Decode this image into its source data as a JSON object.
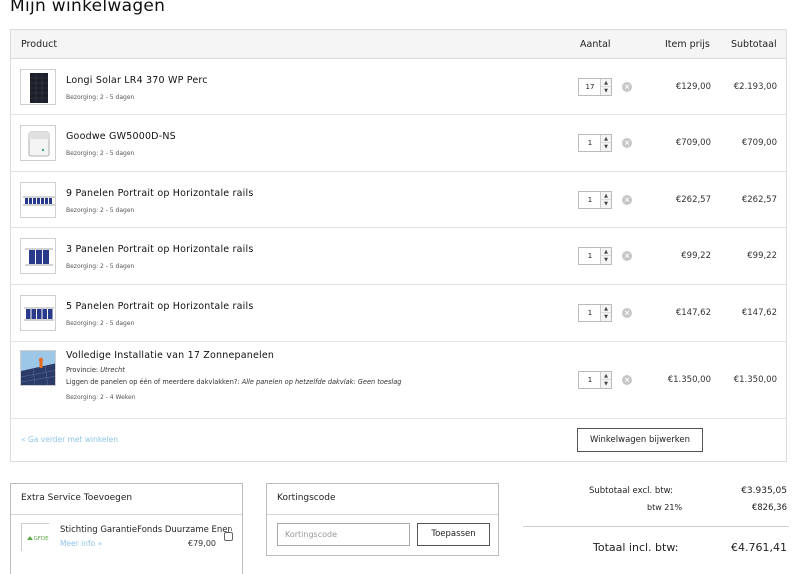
{
  "page": {
    "title": "Mijn winkelwagen"
  },
  "table": {
    "headers": {
      "product": "Product",
      "quantity": "Aantal",
      "item_price": "Item prijs",
      "subtotal": "Subtotaal"
    },
    "items": [
      {
        "name": "Longi Solar LR4 370 WP Perc",
        "delivery": "Bezorging: 2 - 5 dagen",
        "quantity": "17",
        "price": "€129,00",
        "subtotal": "€2.193,00",
        "thumb_icon": "solar-panel-icon"
      },
      {
        "name": "Goodwe GW5000D-NS",
        "delivery": "Bezorging: 2 - 5 dagen",
        "quantity": "1",
        "price": "€709,00",
        "subtotal": "€709,00",
        "thumb_icon": "inverter-icon"
      },
      {
        "name": "9 Panelen Portrait op Horizontale rails",
        "delivery": "Bezorging: 2 - 5 dagen",
        "quantity": "1",
        "price": "€262,57",
        "subtotal": "€262,57",
        "thumb_icon": "mounting-rails-icon"
      },
      {
        "name": "3 Panelen Portrait op Horizontale rails",
        "delivery": "Bezorging: 2 - 5 dagen",
        "quantity": "1",
        "price": "€99,22",
        "subtotal": "€99,22",
        "thumb_icon": "mounting-rails-icon"
      },
      {
        "name": "5 Panelen Portrait op Horizontale rails",
        "delivery": "Bezorging: 2 - 5 dagen",
        "quantity": "1",
        "price": "€147,62",
        "subtotal": "€147,62",
        "thumb_icon": "mounting-rails-icon"
      },
      {
        "name": "Volledige Installatie van 17 Zonnepanelen",
        "province_label": "Provincie:",
        "province_value": "Utrecht",
        "roof_label": "Liggen de panelen op één of meerdere dakvlakken?:",
        "roof_value": "Alle panelen op hetzelfde dakvlak: Geen toeslag",
        "delivery": "Bezorging: 2 - 4 Weken",
        "quantity": "1",
        "price": "€1.350,00",
        "subtotal": "€1.350,00",
        "thumb_icon": "installation-photo-icon"
      }
    ],
    "continue_link": "« Ga verder met winkelen",
    "update_button": "Winkelwagen bijwerken",
    "remove_icon": "remove-x-icon"
  },
  "extra_service": {
    "title": "Extra Service Toevoegen",
    "item": {
      "name": "Stichting GarantieFonds Duurzame Energie",
      "more_link": "Meer info »",
      "price": "€79,00",
      "logo_text": "GFDE"
    }
  },
  "coupon": {
    "title": "Kortingscode",
    "placeholder": "Kortingscode",
    "button": "Toepassen"
  },
  "totals": {
    "subtotal_label": "Subtotaal excl. btw:",
    "subtotal_value": "€3.935,05",
    "vat_label": "btw 21%",
    "vat_value": "€826,36",
    "total_label": "Totaal incl. btw:",
    "total_value": "€4.761,41"
  },
  "colors": {
    "link": "#8fc6e8",
    "border": "#dcdcdc",
    "header_bg": "#f5f5f5"
  }
}
